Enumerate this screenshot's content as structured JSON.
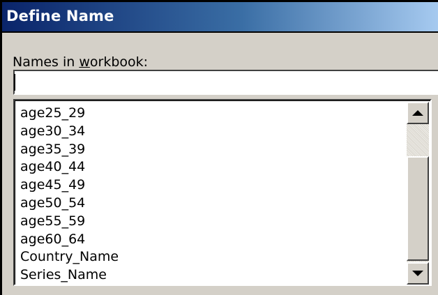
{
  "dialog": {
    "title": "Define Name",
    "names_label_pre": "Names in ",
    "names_label_accel": "w",
    "names_label_post": "orkbook:",
    "name_input_value": "",
    "names": [
      "age25_29",
      "age30_34",
      "age35_39",
      "age40_44",
      "age45_49",
      "age50_54",
      "age55_59",
      "age60_64",
      "Country_Name",
      "Series_Name"
    ]
  },
  "icons": {
    "scroll_up": "scroll-up-arrow-icon",
    "scroll_down": "scroll-down-arrow-icon"
  },
  "colors": {
    "titlebar_start": "#0a246a",
    "titlebar_end": "#a6caf0",
    "dialog_face": "#d4d0c8"
  }
}
